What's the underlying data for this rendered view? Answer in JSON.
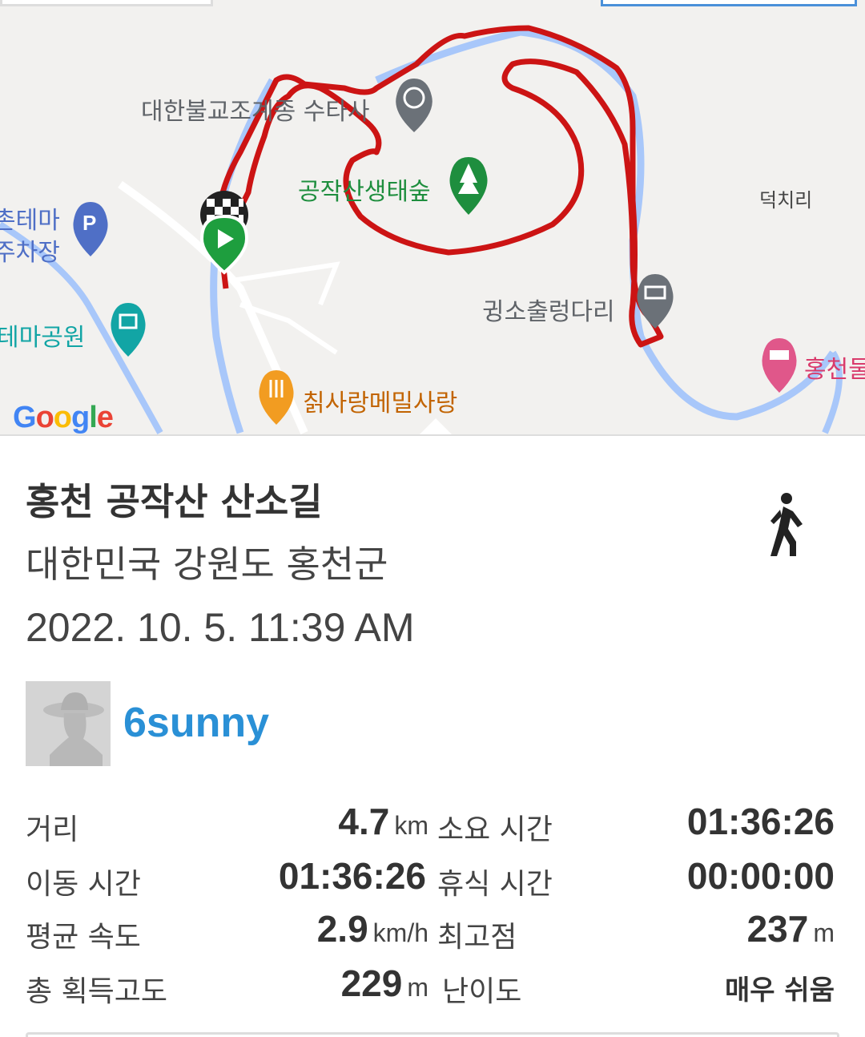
{
  "map": {
    "labels": {
      "temple": "대한불교조계종 수타사",
      "forest": "공작산생태숲",
      "village": "덕치리",
      "parking_1": "촌테마",
      "parking_2": "주차장",
      "park": "테마공원",
      "bridge": "귕소출렁다리",
      "restaurant": "칡사랑메밀사랑",
      "lodging": "홍천둘"
    },
    "logo": "Google",
    "route_color": "#cc1414"
  },
  "trail": {
    "title": "홍천 공작산 산소길",
    "region": "대한민국 강원도 홍천군",
    "datetime": "2022. 10. 5. 11:39 AM",
    "activity_icon": "walking-icon",
    "user": {
      "name": "6sunny",
      "avatar_icon": "person-hat-icon"
    }
  },
  "stats": {
    "distance": {
      "label": "거리",
      "value": "4.7",
      "unit": "km"
    },
    "total_time": {
      "label": "소요 시간",
      "value": "01:36:26"
    },
    "moving_time": {
      "label": "이동 시간",
      "value": "01:36:26"
    },
    "rest_time": {
      "label": "휴식 시간",
      "value": "00:00:00"
    },
    "avg_speed": {
      "label": "평균 속도",
      "value": "2.9",
      "unit": "km/h"
    },
    "max_altitude": {
      "label": "최고점",
      "value": "237",
      "unit": "m"
    },
    "elevation_gain": {
      "label": "총 획득고도",
      "value": "229",
      "unit": "m"
    },
    "difficulty": {
      "label": "난이도",
      "value": "매우 쉬움"
    }
  }
}
